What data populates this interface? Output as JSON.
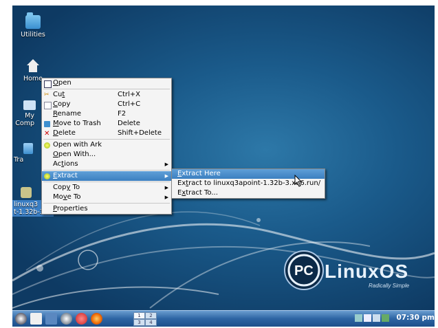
{
  "desktop": {
    "icons": [
      {
        "label": "Utilities"
      },
      {
        "label": "Home"
      },
      {
        "label": "My Comp"
      },
      {
        "label": "Tra"
      },
      {
        "label": "linuxq3\nt-1.32b-3...."
      }
    ]
  },
  "context_menu": {
    "items": [
      {
        "label": "Open",
        "accel": "O",
        "shortcut": ""
      },
      {
        "label": "Cut",
        "accel": "t",
        "shortcut": "Ctrl+X"
      },
      {
        "label": "Copy",
        "accel": "C",
        "shortcut": "Ctrl+C"
      },
      {
        "label": "Rename",
        "accel": "R",
        "shortcut": "F2"
      },
      {
        "label": "Move to Trash",
        "accel": "M",
        "shortcut": "Delete"
      },
      {
        "label": "Delete",
        "accel": "D",
        "shortcut": "Shift+Delete"
      },
      {
        "label": "Open with Ark",
        "accel": "",
        "shortcut": ""
      },
      {
        "label": "Open With...",
        "accel": "O",
        "shortcut": ""
      },
      {
        "label": "Actions",
        "accel": "t",
        "shortcut": ""
      },
      {
        "label": "Extract",
        "accel": "E",
        "shortcut": ""
      },
      {
        "label": "Copy To",
        "accel": "y",
        "shortcut": ""
      },
      {
        "label": "Move To",
        "accel": "v",
        "shortcut": ""
      },
      {
        "label": "Properties",
        "accel": "P",
        "shortcut": ""
      }
    ]
  },
  "submenu": {
    "items": [
      {
        "label": "Extract Here",
        "accel": "E"
      },
      {
        "label": "Extract to linuxq3apoint-1.32b-3.x86.run/",
        "accel": "t"
      },
      {
        "label": "Extract To...",
        "accel": "x"
      }
    ]
  },
  "branding": {
    "logo": "PCLinuxOS",
    "tagline": "Radically Simple"
  },
  "taskbar": {
    "pager": [
      "1",
      "2",
      "3",
      "4"
    ],
    "clock": "07:30 pm"
  },
  "colors": {
    "highlight": "#3b7fc0",
    "desktop": "#1a5a8a",
    "taskbar": "#2d64a3"
  }
}
